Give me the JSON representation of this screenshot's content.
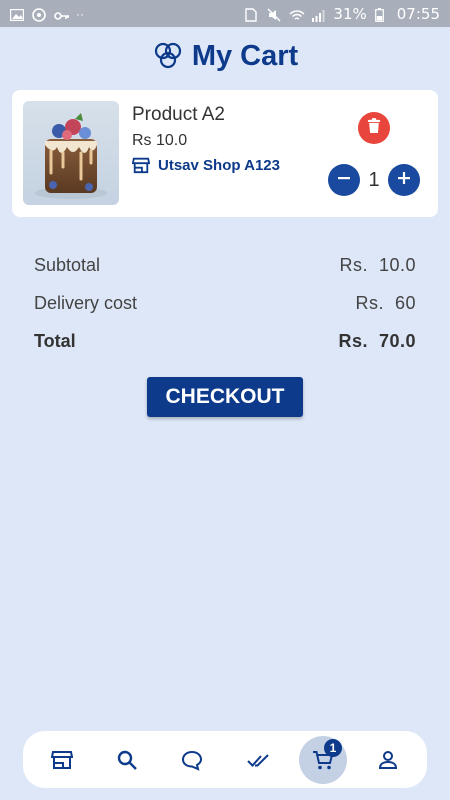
{
  "status_bar": {
    "battery": "31%",
    "time": "07:55"
  },
  "header": {
    "title": "My Cart",
    "icon": "logo-icon"
  },
  "cart_items": [
    {
      "name": "Product A2",
      "price": "Rs 10.0",
      "shop": "Utsav Shop A123",
      "quantity": "1"
    }
  ],
  "summary": {
    "subtotal_label": "Subtotal",
    "subtotal_value": "Rs.  10.0",
    "delivery_label": "Delivery cost",
    "delivery_value": "Rs.  60",
    "total_label": "Total",
    "total_value": "Rs.  70.0"
  },
  "checkout": {
    "label": "CHECKOUT"
  },
  "bottom_nav": {
    "items": [
      "store-icon",
      "search-icon",
      "chat-icon",
      "double-check-icon",
      "cart-icon",
      "profile-icon"
    ],
    "cart_badge": "1"
  },
  "colors": {
    "background": "#dde7f7",
    "primary": "#0d3a8a",
    "danger": "#e8463c"
  }
}
